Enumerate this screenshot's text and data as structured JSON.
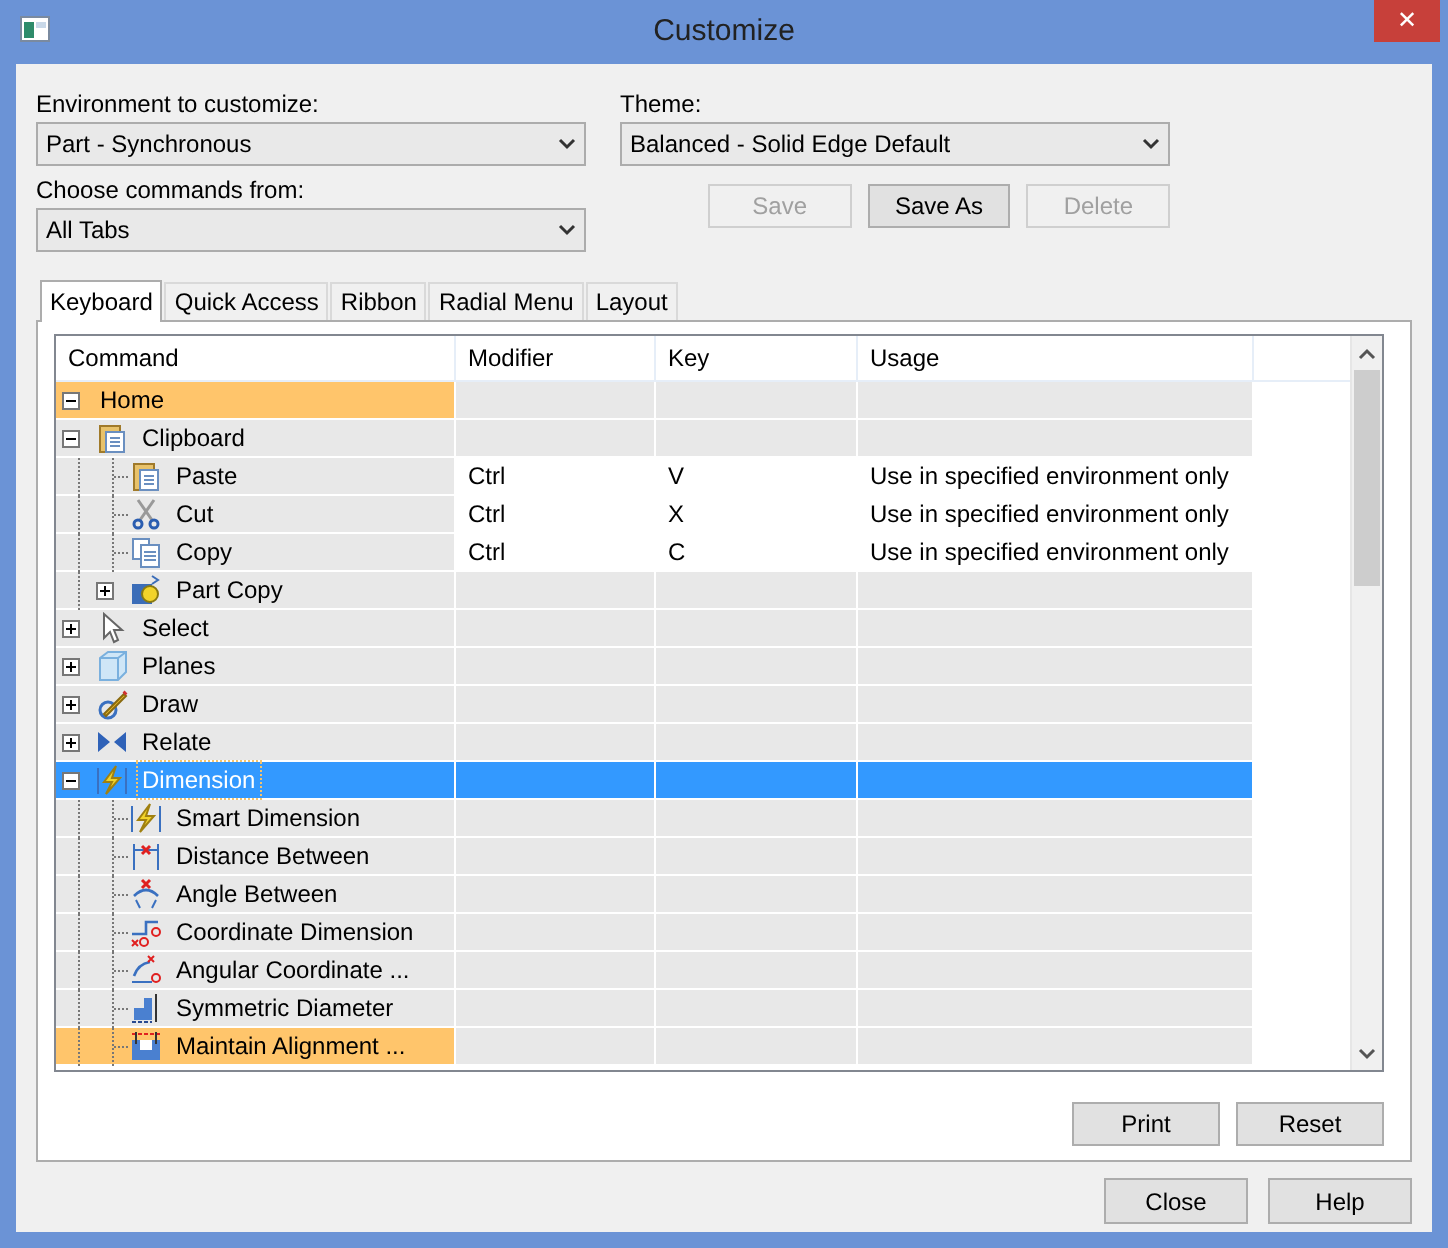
{
  "window": {
    "title": "Customize",
    "close_label": "✕"
  },
  "environment": {
    "label": "Environment to customize:",
    "value": "Part - Synchronous"
  },
  "theme": {
    "label": "Theme:",
    "value": "Balanced - Solid Edge Default"
  },
  "commands_from": {
    "label": "Choose commands from:",
    "value": "All Tabs"
  },
  "theme_buttons": [
    {
      "label": "Save",
      "disabled": true
    },
    {
      "label": "Save As",
      "disabled": false
    },
    {
      "label": "Delete",
      "disabled": true
    }
  ],
  "tabs": [
    {
      "label": "Keyboard",
      "selected": true
    },
    {
      "label": "Quick Access",
      "selected": false
    },
    {
      "label": "Ribbon",
      "selected": false
    },
    {
      "label": "Radial Menu",
      "selected": false
    },
    {
      "label": "Layout",
      "selected": false
    }
  ],
  "grid": {
    "columns": [
      "Command",
      "Modifier",
      "Key",
      "Usage"
    ],
    "rows": [
      {
        "command": "Home",
        "expanded": true,
        "selected": false,
        "highlighted": true,
        "children": [
          {
            "command": "Clipboard",
            "expanded": true,
            "selected": false,
            "highlighted": false,
            "children": [
              {
                "command": "Paste",
                "modifier": "Ctrl",
                "key": "V",
                "usage": "Use in specified environment only",
                "selected": false,
                "highlighted": false
              },
              {
                "command": "Cut",
                "modifier": "Ctrl",
                "key": "X",
                "usage": "Use in specified environment only",
                "selected": false,
                "highlighted": false
              },
              {
                "command": "Copy",
                "modifier": "Ctrl",
                "key": "C",
                "usage": "Use in specified environment only",
                "selected": false,
                "highlighted": false
              },
              {
                "command": "Part Copy",
                "expanded": false,
                "selected": false,
                "highlighted": false
              }
            ]
          },
          {
            "command": "Select",
            "expanded": false,
            "selected": false,
            "highlighted": false
          },
          {
            "command": "Planes",
            "expanded": false,
            "selected": false,
            "highlighted": false
          },
          {
            "command": "Draw",
            "expanded": false,
            "selected": false,
            "highlighted": false
          },
          {
            "command": "Relate",
            "expanded": false,
            "selected": false,
            "highlighted": false
          },
          {
            "command": "Dimension",
            "expanded": true,
            "selected": true,
            "highlighted": false,
            "children": [
              {
                "command": "Smart Dimension",
                "selected": false,
                "highlighted": false
              },
              {
                "command": "Distance Between",
                "selected": false,
                "highlighted": false
              },
              {
                "command": "Angle Between",
                "selected": false,
                "highlighted": false
              },
              {
                "command": "Coordinate Dimension",
                "selected": false,
                "highlighted": false
              },
              {
                "command": "Angular Coordinate ...",
                "selected": false,
                "highlighted": false
              },
              {
                "command": "Symmetric Diameter",
                "selected": false,
                "highlighted": false
              },
              {
                "command": "Maintain Alignment ...",
                "selected": false,
                "highlighted": true
              }
            ]
          }
        ]
      }
    ]
  },
  "panel_buttons": [
    "Print",
    "Reset"
  ],
  "footer_buttons": [
    "Close",
    "Help"
  ]
}
